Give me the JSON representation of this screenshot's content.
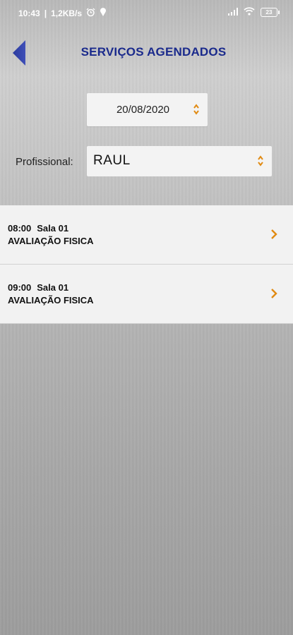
{
  "status_bar": {
    "time": "10:43",
    "speed": "1,2KB/s",
    "battery": "23"
  },
  "header": {
    "title": "SERVIÇOS AGENDADOS",
    "title_color": "#1a2a8c"
  },
  "filters": {
    "date_value": "20/08/2020",
    "professional_label": "Profissional:",
    "professional_value": "RAUL"
  },
  "appointments": [
    {
      "time": "08:00",
      "room": "Sala 01",
      "service": "AVALIAÇÃO FISICA"
    },
    {
      "time": "09:00",
      "room": "Sala 01",
      "service": "AVALIAÇÃO FISICA"
    }
  ],
  "colors": {
    "accent": "#e08a12",
    "nav": "#1a2a8c"
  },
  "icons": [
    "back-arrow-icon",
    "select-arrows-icon",
    "chevron-right-icon",
    "alarm-icon",
    "signal-icon",
    "wifi-icon",
    "battery-icon"
  ]
}
